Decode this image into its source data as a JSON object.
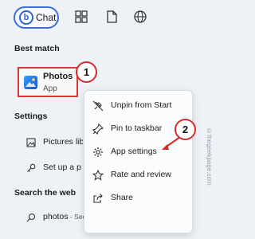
{
  "topbar": {
    "chat_label": "Chat",
    "chat_logo": "b",
    "icons": [
      "grid-icon",
      "document-icon",
      "globe-icon"
    ]
  },
  "best_match": {
    "heading": "Best match",
    "app_name": "Photos",
    "app_type": "App",
    "badge": "1"
  },
  "settings": {
    "heading": "Settings",
    "items": [
      {
        "label": "Pictures lib",
        "icon": "image-icon"
      },
      {
        "label": "Set up a p",
        "icon": "key-icon"
      }
    ]
  },
  "web": {
    "heading": "Search the web",
    "query": "photos",
    "sub": " - See web results"
  },
  "context_menu": {
    "items": [
      {
        "label": "Unpin from Start",
        "icon": "unpin-icon"
      },
      {
        "label": "Pin to taskbar",
        "icon": "pin-icon"
      },
      {
        "label": "App settings",
        "icon": "gear-icon"
      },
      {
        "label": "Rate and review",
        "icon": "star-icon"
      },
      {
        "label": "Share",
        "icon": "share-icon"
      }
    ],
    "badge": "2"
  },
  "watermark": "©thegeekpage.com",
  "colors": {
    "accent": "#3f6fd6",
    "highlight": "#e03535",
    "background": "#eef2f6"
  }
}
